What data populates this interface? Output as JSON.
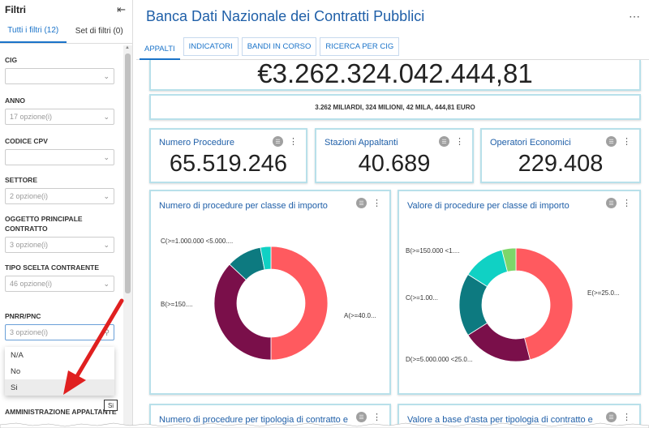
{
  "sidebar": {
    "title": "Filtri",
    "tabs": [
      {
        "label": "Tutti i filtri (12)",
        "active": true
      },
      {
        "label": "Set di filtri (0)",
        "active": false
      }
    ],
    "filters": [
      {
        "label": "CIG",
        "value": ""
      },
      {
        "label": "ANNO",
        "value": "17 opzione(i)"
      },
      {
        "label": "CODICE CPV",
        "value": ""
      },
      {
        "label": "SETTORE",
        "value": "2 opzione(i)"
      },
      {
        "label": "OGGETTO PRINCIPALE CONTRATTO",
        "value": "3 opzione(i)"
      },
      {
        "label": "TIPO SCELTA CONTRAENTE",
        "value": "46 opzione(i)"
      },
      {
        "label": "PNRR/PNC",
        "value": "3 opzione(i)"
      },
      {
        "label": "AMMINISTRAZIONE APPALTANTE",
        "value": ""
      }
    ],
    "dropdown_options": [
      "N/A",
      "No",
      "Si"
    ],
    "selected_tag": "Si"
  },
  "header": {
    "title": "Banca Dati Nazionale dei Contratti Pubblici",
    "tabs": [
      "APPALTI",
      "INDICATORI",
      "BANDI IN CORSO",
      "RICERCA PER CIG"
    ]
  },
  "total": {
    "value": "€3.262.324.042.444,81",
    "caption": "3.262 MILIARDI, 324 MILIONI, 42 MILA, 444,81 EURO"
  },
  "kpis": [
    {
      "title": "Numero Procedure",
      "value": "65.519.246"
    },
    {
      "title": "Stazioni Appaltanti",
      "value": "40.689"
    },
    {
      "title": "Operatori Economici",
      "value": "229.408"
    }
  ],
  "chart_data": [
    {
      "type": "pie",
      "title": "Numero di procedure per classe di importo",
      "labels": [
        "A(>=40.0...",
        "B(>=150....",
        "C(>=1.000.000 <5.000....",
        ""
      ],
      "values": [
        50,
        37,
        10,
        3
      ],
      "colors": [
        "#ff5a5f",
        "#7a0f4a",
        "#0d7a80",
        "#10d1c4"
      ]
    },
    {
      "type": "pie",
      "title": "Valore di procedure per classe di importo",
      "labels": [
        "E(>=25.0...",
        "D(>=5.000.000 <25.0...",
        "C(>=1.00...",
        "B(>=150.000 <1....",
        ""
      ],
      "values": [
        46,
        20,
        18,
        12,
        4
      ],
      "colors": [
        "#ff5a5f",
        "#7a0f4a",
        "#0d7a80",
        "#10d1c4",
        "#7dd66a"
      ]
    }
  ],
  "bottom_cards": [
    {
      "title": "Numero di procedure per tipologia di contratto e"
    },
    {
      "title": "Valore a base d'asta per tipologia di contratto e"
    }
  ]
}
